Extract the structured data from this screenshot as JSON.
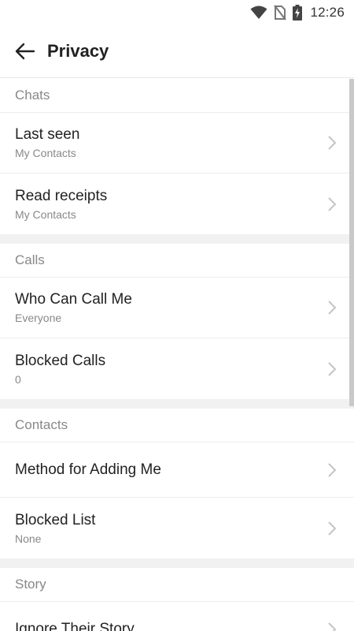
{
  "status_bar": {
    "time": "12:26",
    "icons": [
      "wifi-icon",
      "no-sim-icon",
      "battery-charging-icon"
    ]
  },
  "header": {
    "title": "Privacy",
    "back_icon": "arrow-left-icon"
  },
  "sections": [
    {
      "title": "Chats",
      "rows": [
        {
          "label": "Last seen",
          "value": "My Contacts"
        },
        {
          "label": "Read receipts",
          "value": "My Contacts"
        }
      ]
    },
    {
      "title": "Calls",
      "rows": [
        {
          "label": "Who Can Call Me",
          "value": "Everyone"
        },
        {
          "label": "Blocked Calls",
          "value": "0"
        }
      ]
    },
    {
      "title": "Contacts",
      "rows": [
        {
          "label": "Method for Adding Me"
        },
        {
          "label": "Blocked List",
          "value": "None"
        }
      ]
    },
    {
      "title": "Story",
      "rows": [
        {
          "label": "Ignore Their Story"
        }
      ]
    }
  ],
  "colors": {
    "text_primary": "#222222",
    "text_secondary": "#888888",
    "divider": "#ececec",
    "section_gap": "#f1f1f1"
  }
}
